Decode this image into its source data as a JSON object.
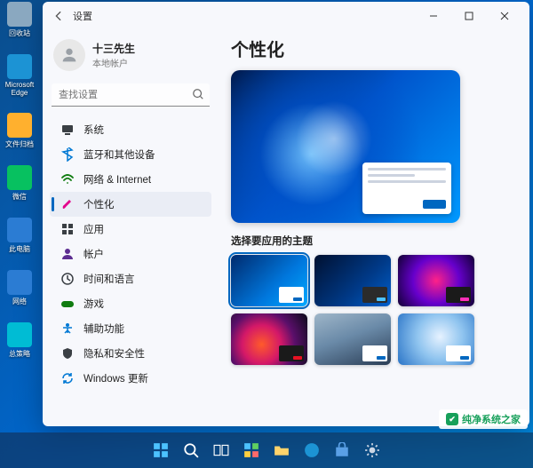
{
  "desktop": {
    "icons": [
      {
        "label": "回收站",
        "color": "#8aa8c0"
      },
      {
        "label": "Microsoft Edge",
        "color": "#1c93d4"
      },
      {
        "label": "文件归档",
        "color": "#ffb02e"
      },
      {
        "label": "微信",
        "color": "#07c160"
      },
      {
        "label": "此电脑",
        "color": "#2b7cd3"
      },
      {
        "label": "网络",
        "color": "#2b7cd3"
      },
      {
        "label": "总策略",
        "color": "#00bcd4"
      }
    ]
  },
  "window": {
    "title": "设置",
    "user": {
      "name": "十三先生",
      "type": "本地帐户"
    },
    "search_placeholder": "查找设置",
    "nav": [
      {
        "id": "system",
        "label": "系统",
        "icon": "monitor",
        "color": "#3a3f44"
      },
      {
        "id": "bluetooth",
        "label": "蓝牙和其他设备",
        "icon": "bluetooth",
        "color": "#0078d4"
      },
      {
        "id": "network",
        "label": "网络 & Internet",
        "icon": "wifi",
        "color": "#107c10"
      },
      {
        "id": "personalization",
        "label": "个性化",
        "icon": "brush",
        "color": "#e3008c",
        "active": true
      },
      {
        "id": "apps",
        "label": "应用",
        "icon": "grid",
        "color": "#3a3f44"
      },
      {
        "id": "accounts",
        "label": "帐户",
        "icon": "person",
        "color": "#5c2d91"
      },
      {
        "id": "time",
        "label": "时间和语言",
        "icon": "clock",
        "color": "#3a3f44"
      },
      {
        "id": "gaming",
        "label": "游戏",
        "icon": "game",
        "color": "#107c10"
      },
      {
        "id": "accessibility",
        "label": "辅助功能",
        "icon": "access",
        "color": "#0078d4"
      },
      {
        "id": "privacy",
        "label": "隐私和安全性",
        "icon": "shield",
        "color": "#3a3f44"
      },
      {
        "id": "update",
        "label": "Windows 更新",
        "icon": "sync",
        "color": "#0078d4"
      }
    ]
  },
  "main": {
    "heading": "个性化",
    "section_label": "选择要应用的主题",
    "themes": [
      {
        "id": "light-blue",
        "card_bg": "#ffffff",
        "accent": "#0067c0",
        "selected": true,
        "cls": "t1"
      },
      {
        "id": "dark-blue",
        "card_bg": "#2b2b2b",
        "accent": "#4cc2ff",
        "selected": false,
        "cls": "t2"
      },
      {
        "id": "neon",
        "card_bg": "#1a1a1a",
        "accent": "#ff2fb9",
        "selected": false,
        "cls": "t3"
      },
      {
        "id": "flower-dark",
        "card_bg": "#1a1a1a",
        "accent": "#e81123",
        "selected": false,
        "cls": "t4"
      },
      {
        "id": "grey-light",
        "card_bg": "#ffffff",
        "accent": "#0067c0",
        "selected": false,
        "cls": "t5"
      },
      {
        "id": "swirl-light",
        "card_bg": "#ffffff",
        "accent": "#0067c0",
        "selected": false,
        "cls": "t6"
      }
    ]
  },
  "taskbar": {
    "items": [
      "start",
      "search",
      "taskview",
      "widgets",
      "explorer",
      "edge",
      "store",
      "settings"
    ]
  },
  "watermark": {
    "text": "纯净系统之家",
    "url": "www.ycwjzy.com"
  }
}
